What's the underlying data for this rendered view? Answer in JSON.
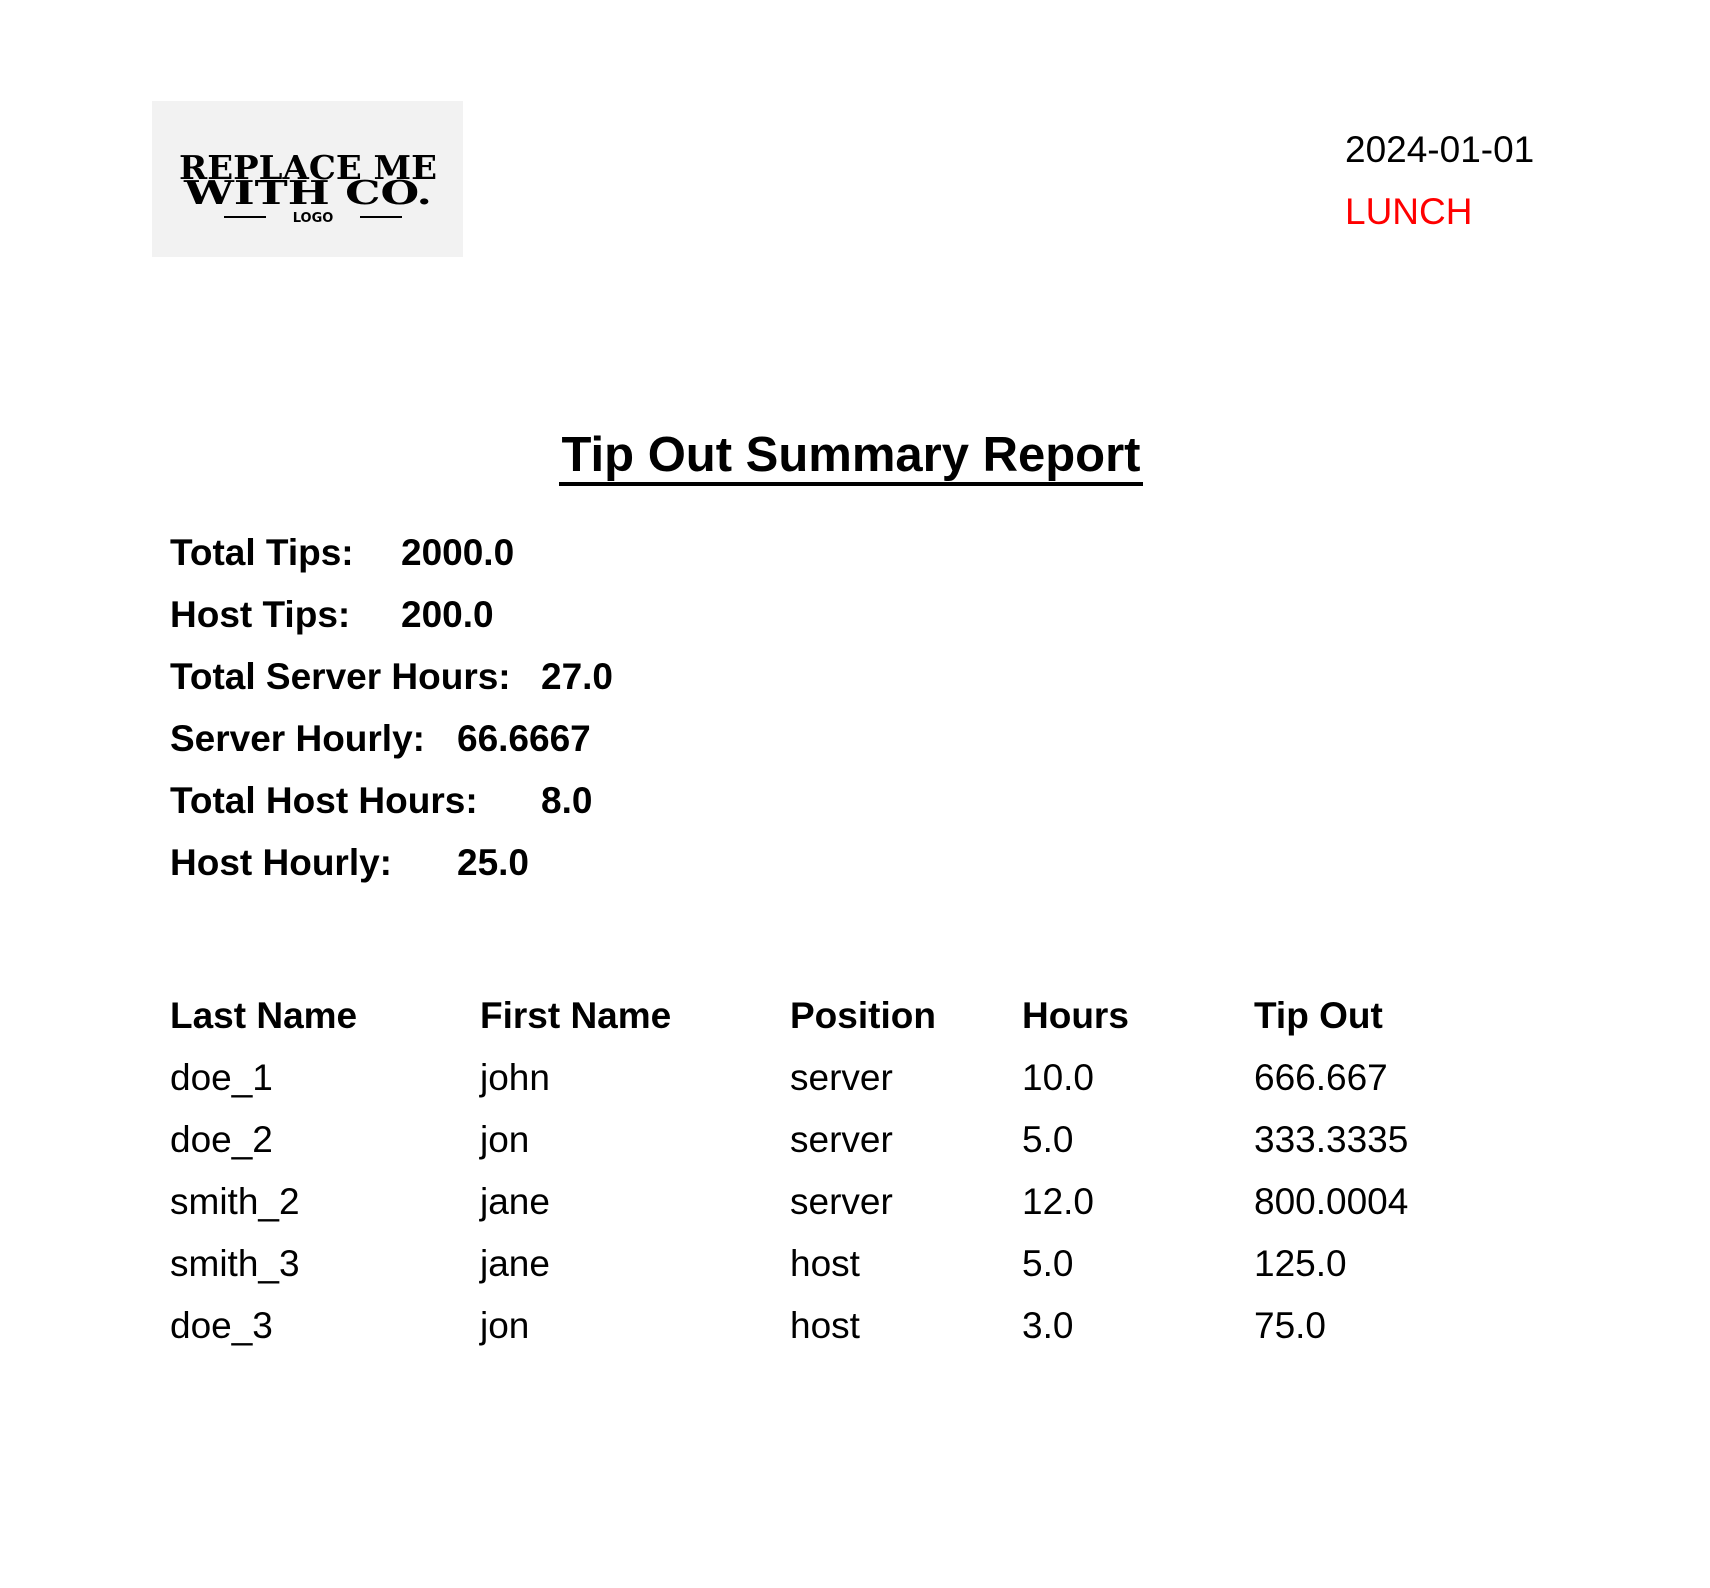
{
  "logo": {
    "line1": "REPLACE ME",
    "line2": "WITH CO.",
    "line3": "LOGO"
  },
  "header": {
    "date": "2024-01-01",
    "shift": "LUNCH",
    "shift_color": "#ff0000"
  },
  "title": "Tip Out Summary Report",
  "summary": [
    {
      "label": "Total Tips:",
      "value": "2000.0"
    },
    {
      "label": "Host Tips:",
      "value": "200.0"
    },
    {
      "label": "Total Server Hours:",
      "value": "27.0"
    },
    {
      "label": "Server Hourly:",
      "value": "66.6667"
    },
    {
      "label": "Total Host Hours:",
      "value": "8.0"
    },
    {
      "label": "Host Hourly:",
      "value": "25.0"
    }
  ],
  "table": {
    "headers": [
      "Last Name",
      "First Name",
      "Position",
      "Hours",
      "Tip Out"
    ],
    "rows": [
      [
        "doe_1",
        "john",
        "server",
        "10.0",
        "666.667"
      ],
      [
        "doe_2",
        "jon",
        "server",
        "5.0",
        "333.3335"
      ],
      [
        "smith_2",
        "jane",
        "server",
        "12.0",
        "800.0004"
      ],
      [
        "smith_3",
        "jane",
        "host",
        "5.0",
        "125.0"
      ],
      [
        "doe_3",
        "jon",
        "host",
        "3.0",
        "75.0"
      ]
    ]
  }
}
